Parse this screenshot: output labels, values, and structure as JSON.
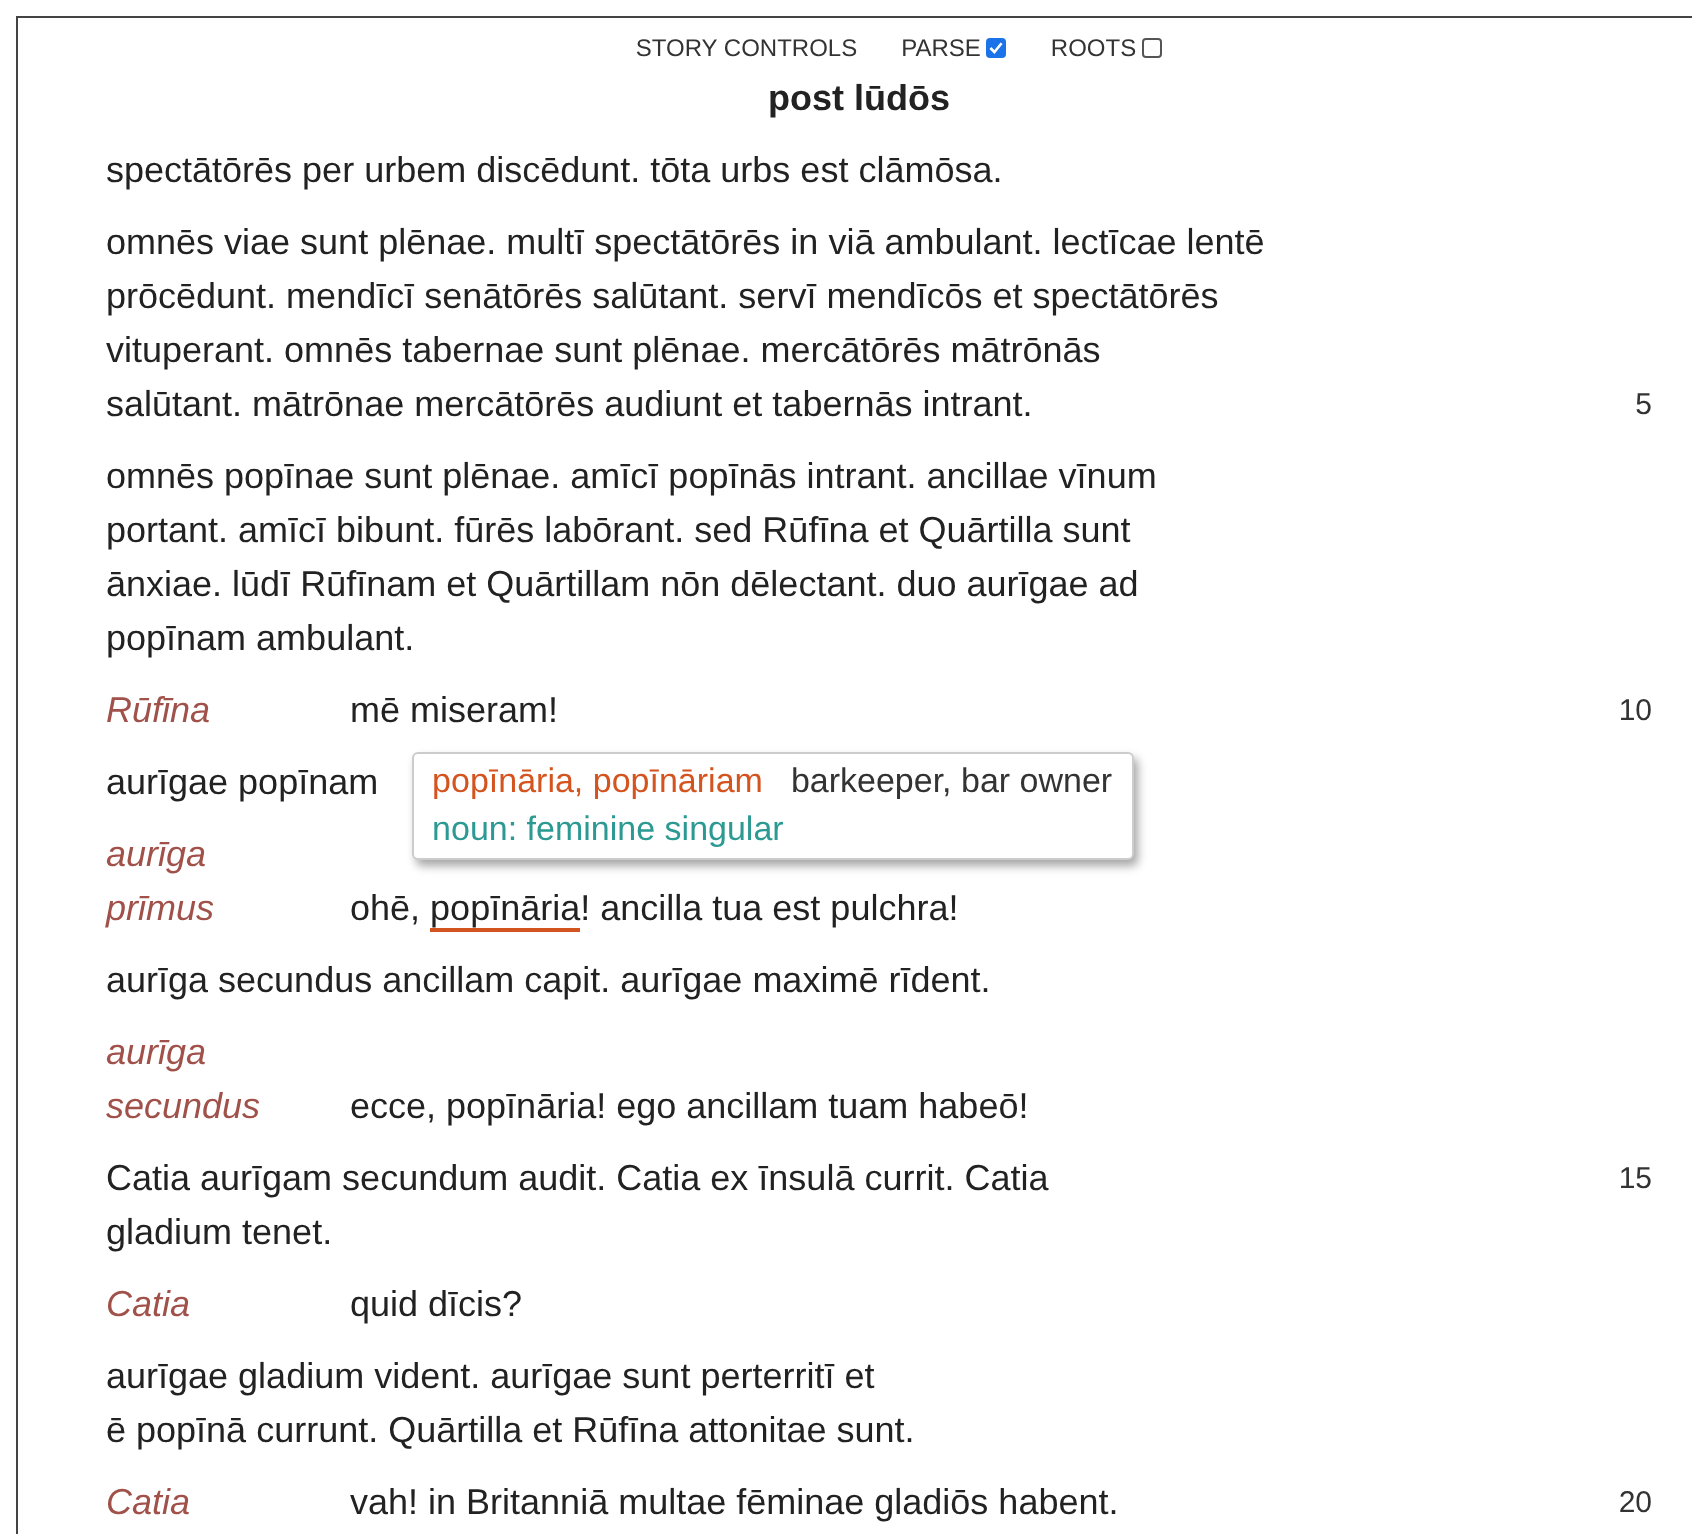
{
  "controls": {
    "label": "STORY CONTROLS",
    "options": [
      {
        "label": "PARSE",
        "checked": true
      },
      {
        "label": "ROOTS",
        "checked": false
      }
    ]
  },
  "title": "post lūdōs",
  "blocks": [
    {
      "kind": "narration",
      "lines": [
        {
          "text": "spectātōrēs per urbem discēdunt. tōta urbs est clāmōsa."
        }
      ]
    },
    {
      "kind": "narration",
      "lines": [
        {
          "text": "omnēs viae sunt plēnae. multī spectātōrēs in viā ambulant. lectīcae lentē"
        },
        {
          "text": "prōcēdunt. mendīcī senātōrēs salūtant. servī mendīcōs et spectātōrēs"
        },
        {
          "text": "vituperant. omnēs tabernae sunt plēnae. mercātōrēs mātrōnās"
        },
        {
          "text": "salūtant. mātrōnae mercātōrēs audiunt et tabernās intrant.",
          "number": "5"
        }
      ]
    },
    {
      "kind": "narration",
      "lines": [
        {
          "text": "omnēs popīnae sunt plēnae. amīcī popīnās intrant. ancillae vīnum"
        },
        {
          "text": "portant. amīcī bibunt. fūrēs labōrant. sed Rūfīna et Quārtilla sunt"
        },
        {
          "text": "ānxiae. lūdī Rūfīnam et Quārtillam nōn dēlectant. duo aurīgae ad"
        },
        {
          "text": "popīnam ambulant."
        }
      ]
    },
    {
      "kind": "speech",
      "speaker": [
        "Rūfīna"
      ],
      "parts": [
        {
          "text": "mē miseram!",
          "selected": false
        }
      ],
      "number": "10"
    },
    {
      "kind": "narration",
      "lines": [
        {
          "text": "aurīgae popīnam"
        }
      ]
    },
    {
      "kind": "speech",
      "speaker": [
        "aurīga",
        "prīmus"
      ],
      "parts": [
        {
          "text": "ohē, ",
          "selected": false
        },
        {
          "text": "popīnāria",
          "selected": true
        },
        {
          "text": "! ancilla tua est pulchra!",
          "selected": false
        }
      ]
    },
    {
      "kind": "narration",
      "lines": [
        {
          "text": "aurīga secundus ancillam capit. aurīgae maximē rīdent."
        }
      ]
    },
    {
      "kind": "speech",
      "speaker": [
        "aurīga",
        "secundus"
      ],
      "parts": [
        {
          "text": "ecce, popīnāria! ego ancillam tuam habeō!",
          "selected": false
        }
      ]
    },
    {
      "kind": "narration",
      "lines": [
        {
          "text": "Catia aurīgam secundum audit. Catia ex īnsulā currit. Catia",
          "number": "15"
        },
        {
          "text": "gladium tenet."
        }
      ]
    },
    {
      "kind": "speech",
      "speaker": [
        "Catia"
      ],
      "parts": [
        {
          "text": "quid dīcis?",
          "selected": false
        }
      ]
    },
    {
      "kind": "narration",
      "lines": [
        {
          "text": "aurīgae gladium vident. aurīgae sunt perterritī et"
        },
        {
          "text": "ē popīnā currunt. Quārtilla et Rūfīna attonitae sunt."
        }
      ]
    },
    {
      "kind": "speech",
      "speaker": [
        "Catia"
      ],
      "parts": [
        {
          "text": "vah! in Britanniā multae fēminae gladiōs habent.",
          "selected": false
        }
      ],
      "number": "20"
    }
  ],
  "gloss": {
    "lemma": "popīnāria, popīnāriam",
    "meaning": "barkeeper, bar owner",
    "parse": "noun: feminine singular"
  }
}
